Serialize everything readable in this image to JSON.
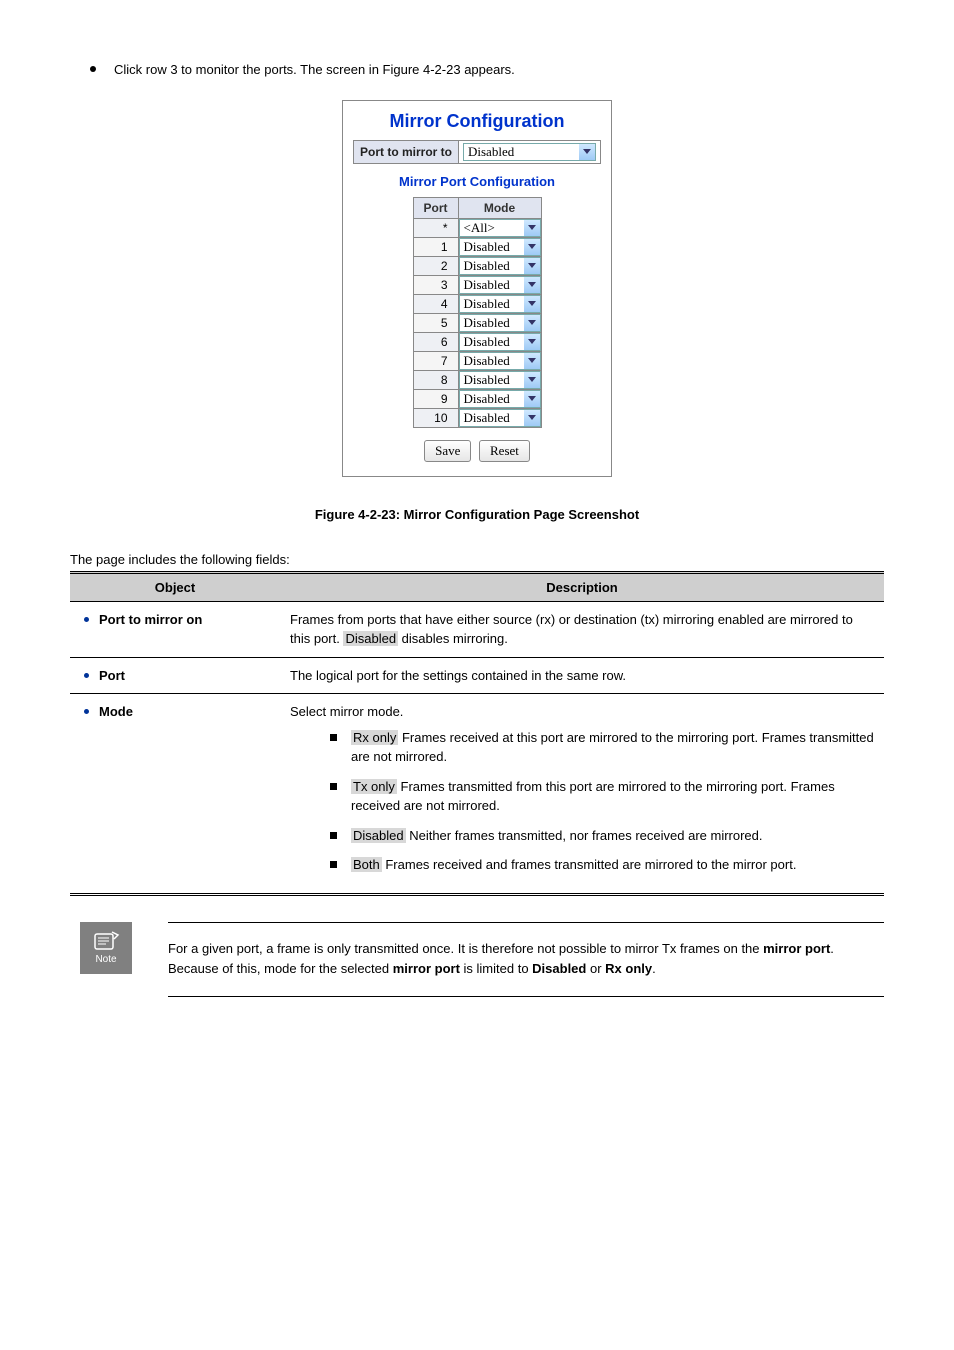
{
  "intro": "Click row 3 to monitor the ports. The screen in Figure 4-2-23 appears.",
  "panel": {
    "title": "Mirror Configuration",
    "target_label": "Port to mirror to",
    "target_value": "Disabled",
    "sub_title": "Mirror Port Configuration",
    "columns": [
      "Port",
      "Mode"
    ],
    "rows": [
      {
        "port": "*",
        "mode": "<All>"
      },
      {
        "port": "1",
        "mode": "Disabled"
      },
      {
        "port": "2",
        "mode": "Disabled"
      },
      {
        "port": "3",
        "mode": "Disabled"
      },
      {
        "port": "4",
        "mode": "Disabled"
      },
      {
        "port": "5",
        "mode": "Disabled"
      },
      {
        "port": "6",
        "mode": "Disabled"
      },
      {
        "port": "7",
        "mode": "Disabled"
      },
      {
        "port": "8",
        "mode": "Disabled"
      },
      {
        "port": "9",
        "mode": "Disabled"
      },
      {
        "port": "10",
        "mode": "Disabled"
      }
    ],
    "buttons": {
      "save": "Save",
      "reset": "Reset"
    }
  },
  "figure_caption": "Figure 4-2-23: Mirror Configuration Page Screenshot",
  "table_lead": "The page includes the following fields:",
  "desc_table": {
    "headers": [
      "Object",
      "Description"
    ],
    "rows": [
      {
        "object": "Port to mirror on",
        "desc_parts": [
          "Frames from ports that have either source (rx) or destination (tx) mirroring enabled are mirrored to this port. ",
          "Disabled",
          " disables mirroring."
        ]
      },
      {
        "object": "Port",
        "desc": "The logical port for the settings contained in the same row."
      },
      {
        "object": "Mode",
        "desc": "Select mirror mode.",
        "items": [
          {
            "key": "Rx only",
            "text": "Frames received at this port are mirrored to the mirroring port. Frames transmitted are not mirrored."
          },
          {
            "key": "Tx only",
            "text": "Frames transmitted from this port are mirrored to the mirroring port. Frames received are not mirrored."
          },
          {
            "key": "Disabled",
            "text": "Neither frames transmitted, nor frames received are mirrored."
          },
          {
            "key": "Both",
            "text": "Frames received and frames transmitted are mirrored to the mirror port."
          }
        ]
      }
    ]
  },
  "note": "For a given port, a frame is only transmitted once. It is therefore not possible to mirror Tx frames on the mirror port. Because of this, mode for the selected mirror port is limited to Disabled or Rx only."
}
